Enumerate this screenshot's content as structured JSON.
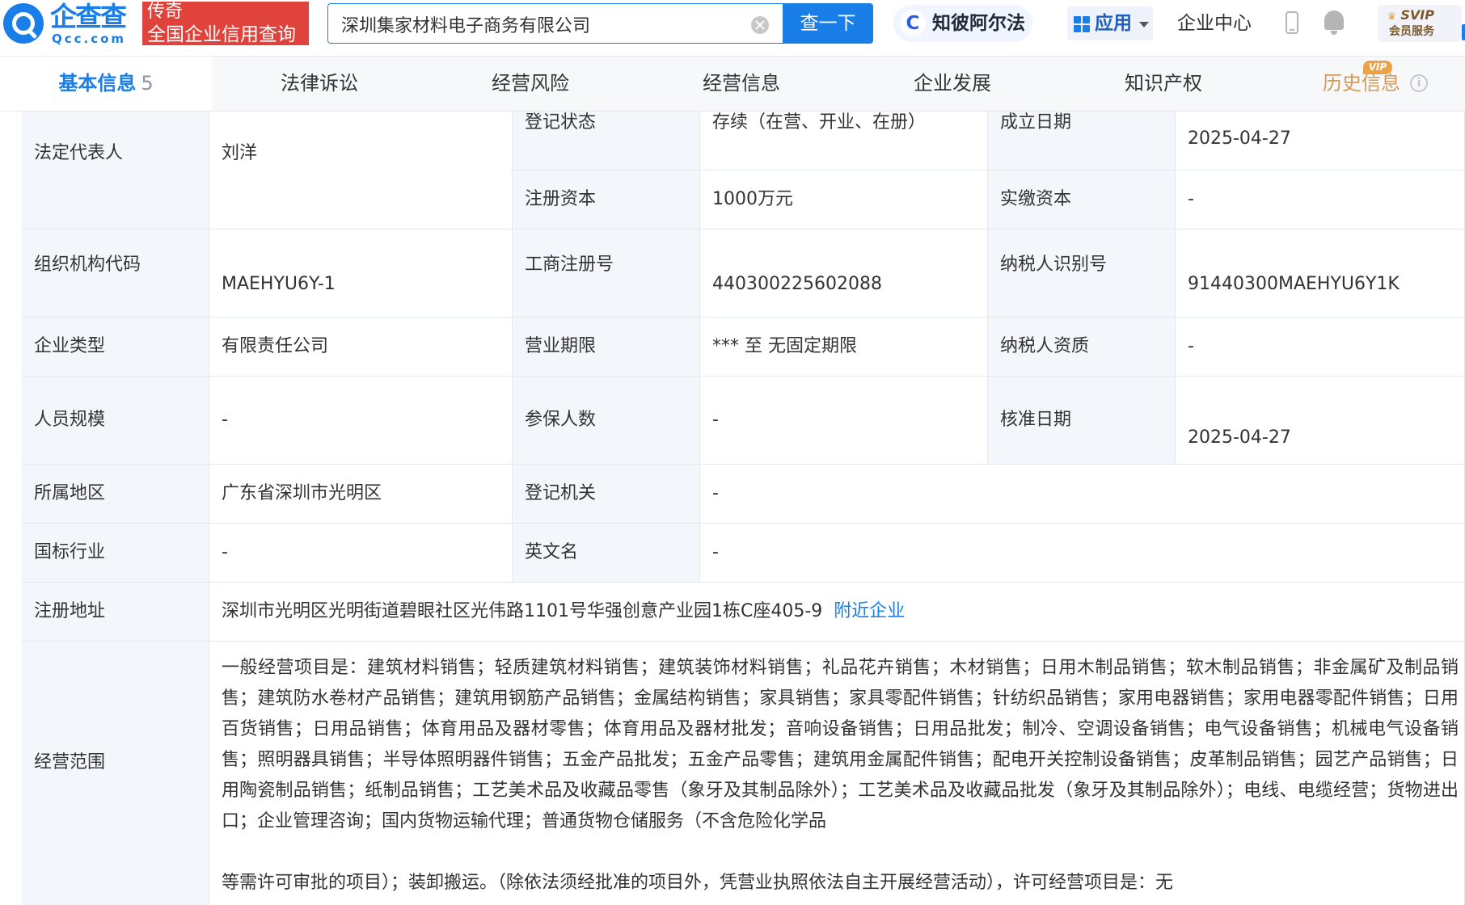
{
  "header": {
    "logo_cn": "企查查",
    "logo_en": "Qcc.com",
    "promo_top": "传奇",
    "promo_bottom": "全国企业信用查询",
    "search_value": "深圳集家材料电子商务有限公司",
    "search_button": "查一下",
    "ai_badge_icon": "C",
    "ai_badge": "知彼阿尔法",
    "apps_menu": "应用",
    "enterprise_center": "企业中心",
    "svip_title": "SVIP",
    "svip_sub": "会员服务"
  },
  "tabs": {
    "basic_info": "基本信息",
    "basic_info_count": "5",
    "legal": "法律诉讼",
    "risk": "经营风险",
    "operation": "经营信息",
    "development": "企业发展",
    "ip": "知识产权",
    "history": "历史信息",
    "vip_tag": "VIP",
    "info_glyph": "i"
  },
  "info": {
    "legal_rep_label": "法定代表人",
    "legal_rep_value": "刘洋",
    "reg_status_label": "登记状态",
    "reg_status_value": "存续（在营、开业、在册）",
    "founded_label": "成立日期",
    "founded_value": "2025-04-27",
    "reg_capital_label": "注册资本",
    "reg_capital_value": "1000万元",
    "paid_capital_label": "实缴资本",
    "paid_capital_value": "-",
    "org_code_label": "组织机构代码",
    "org_code_value": "MAEHYU6Y-1",
    "biz_reg_no_label": "工商注册号",
    "biz_reg_no_value": "440300225602088",
    "taxpayer_id_label": "纳税人识别号",
    "taxpayer_id_value": "91440300MAEHYU6Y1K",
    "company_type_label": "企业类型",
    "company_type_value": "有限责任公司",
    "term_label": "营业期限",
    "term_value": "*** 至 无固定期限",
    "taxpayer_qual_label": "纳税人资质",
    "taxpayer_qual_value": "-",
    "staff_size_label": "人员规模",
    "staff_size_value": "-",
    "insured_label": "参保人数",
    "insured_value": "-",
    "approval_date_label": "核准日期",
    "approval_date_value": "2025-04-27",
    "region_label": "所属地区",
    "region_value": "广东省深圳市光明区",
    "reg_authority_label": "登记机关",
    "reg_authority_value": "-",
    "industry_label": "国标行业",
    "industry_value": "-",
    "english_name_label": "英文名",
    "english_name_value": "-",
    "address_label": "注册地址",
    "address_value": "深圳市光明区光明街道碧眼社区光伟路1101号华强创意产业园1栋C座405-9",
    "nearby_link": "附近企业",
    "scope_label": "经营范围",
    "scope_text": "一般经营项目是：建筑材料销售；轻质建筑材料销售；建筑装饰材料销售；礼品花卉销售；木材销售；日用木制品销售；软木制品销售；非金属矿及制品销售；建筑防水卷材产品销售；建筑用钢筋产品销售；金属结构销售；家具销售；家具零配件销售；针纺织品销售；家用电器销售；家用电器零配件销售；日用百货销售；日用品销售；体育用品及器材零售；体育用品及器材批发；音响设备销售；日用品批发；制冷、空调设备销售；电气设备销售；机械电气设备销售；照明器具销售；半导体照明器件销售；五金产品批发；五金产品零售；建筑用金属配件销售；配电开关控制设备销售；皮革制品销售；园艺产品销售；日用陶瓷制品销售；纸制品销售；工艺美术品及收藏品零售（象牙及其制品除外）；工艺美术品及收藏品批发（象牙及其制品除外）；电线、电缆经营；货物进出口；企业管理咨询；国内货物运输代理；普通货物仓储服务（不含危险化学品",
    "scope_tail": "等需许可审批的项目）；装卸搬运。（除依法须经批准的项目外，凭营业执照依法自主开展经营活动），许可经营项目是：无"
  },
  "colors": {
    "accent": "#1a7ee8",
    "promo": "#e0433b",
    "label_bg": "#f3f6fb",
    "vip": "#efa245"
  },
  "icons": [
    "qcc-logo-icon",
    "clear-icon",
    "ai-alpha-icon",
    "grid-icon",
    "chevron-down-icon",
    "phone-icon",
    "bell-icon",
    "crown-icon",
    "info-icon"
  ]
}
